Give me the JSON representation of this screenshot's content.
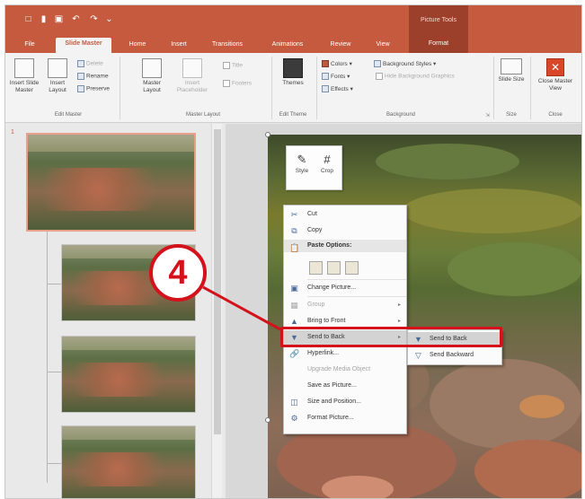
{
  "title_bar": {
    "qat_icons": [
      "new-file-icon",
      "folder-icon",
      "save-icon",
      "undo-icon",
      "redo-icon",
      "customize-icon"
    ],
    "contextual_group": "Picture Tools"
  },
  "tabs": [
    {
      "label": "File",
      "active": false
    },
    {
      "label": "Slide Master",
      "active": true
    },
    {
      "label": "Home",
      "active": false
    },
    {
      "label": "Insert",
      "active": false
    },
    {
      "label": "Transitions",
      "active": false
    },
    {
      "label": "Animations",
      "active": false
    },
    {
      "label": "Review",
      "active": false
    },
    {
      "label": "View",
      "active": false
    },
    {
      "label": "Format",
      "active": false
    }
  ],
  "ribbon": {
    "edit_master": {
      "insert_slide_master": "Insert Slide Master",
      "insert_layout": "Insert Layout",
      "delete": "Delete",
      "rename": "Rename",
      "preserve": "Preserve",
      "group_label": "Edit Master"
    },
    "master_layout": {
      "master_layout": "Master Layout",
      "insert_placeholder": "Insert Placeholder",
      "title": "Title",
      "footers": "Footers",
      "group_label": "Master Layout"
    },
    "edit_theme": {
      "themes": "Themes",
      "group_label": "Edit Theme"
    },
    "background": {
      "colors": "Colors",
      "fonts": "Fonts",
      "effects": "Effects",
      "background_styles": "Background Styles",
      "hide_background_graphics": "Hide Background Graphics",
      "group_label": "Background"
    },
    "size": {
      "slide_size": "Slide Size",
      "group_label": "Size"
    },
    "close": {
      "close_master_view": "Close Master View",
      "group_label": "Close"
    }
  },
  "slides": {
    "master_number": "1"
  },
  "mini_toolbar": {
    "style": "Style",
    "crop": "Crop"
  },
  "context_menu": {
    "items": [
      {
        "label": "Cut",
        "icon": "scissors-icon"
      },
      {
        "label": "Copy",
        "icon": "copy-icon"
      },
      {
        "label": "Paste Options:",
        "icon": "clipboard-icon"
      },
      {
        "label": "Change Picture...",
        "icon": "change-picture-icon"
      },
      {
        "label": "Group",
        "icon": "group-icon"
      },
      {
        "label": "Bring to Front",
        "icon": "bring-front-icon"
      },
      {
        "label": "Send to Back",
        "icon": "send-back-icon"
      },
      {
        "label": "Hyperlink...",
        "icon": "hyperlink-icon"
      },
      {
        "label": "Upgrade Media Object",
        "icon": ""
      },
      {
        "label": "Save as Picture...",
        "icon": ""
      },
      {
        "label": "Size and Position...",
        "icon": "size-position-icon"
      },
      {
        "label": "Format Picture...",
        "icon": "format-picture-icon"
      }
    ]
  },
  "submenu": {
    "items": [
      {
        "label": "Send to Back",
        "icon": "send-back-icon"
      },
      {
        "label": "Send Backward",
        "icon": "send-backward-icon"
      }
    ]
  },
  "callout": {
    "step": "4",
    "color": "#d3121b"
  },
  "colors": {
    "accent": "#c55a3f",
    "contextual_tab": "#9c3f2b"
  }
}
